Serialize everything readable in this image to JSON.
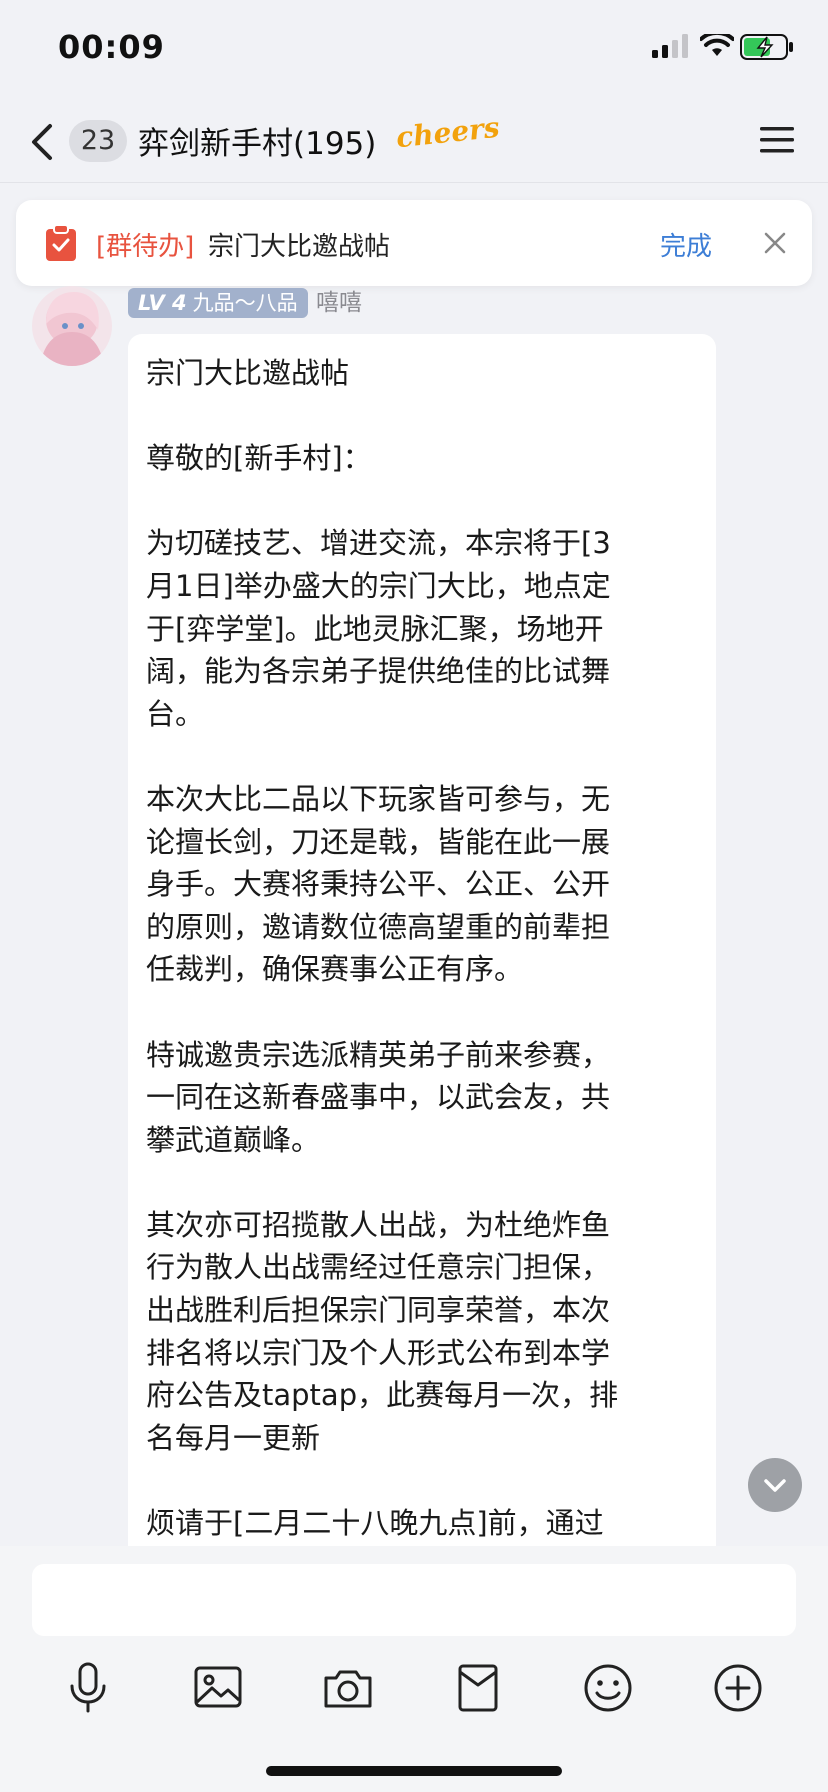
{
  "status": {
    "time": "00:09"
  },
  "nav": {
    "unread_count": "23",
    "title": "弈剑新手村(195)",
    "title_sticker": "cheers"
  },
  "todo": {
    "tag": "[群待办]",
    "text": "宗门大比邀战帖",
    "done_label": "完成"
  },
  "message": {
    "level_badge": "LV 4",
    "rank": "九品～八品",
    "nickname": "嘻嘻",
    "text": "宗门大比邀战帖\n\n尊敬的[新手村]：\n\n为切磋技艺、增进交流，本宗将于[3\n月1日]举办盛大的宗门大比，地点定\n于[弈学堂]。此地灵脉汇聚，场地开\n阔，能为各宗弟子提供绝佳的比试舞\n台。\n\n本次大比二品以下玩家皆可参与，无\n论擅长剑，刀还是戟，皆能在此一展\n身手。大赛将秉持公平、公正、公开\n的原则，邀请数位德高望重的前辈担\n任裁判，确保赛事公正有序。\n\n特诚邀贵宗选派精英弟子前来参赛，\n一同在这新春盛事中，以武会友，共\n攀武道巅峰。\n\n其次亦可招揽散人出战，为杜绝炸鱼\n行为散人出战需经过任意宗门担保，\n出战胜利后担保宗门同享荣誉，本次\n排名将以宗门及个人形式公布到本学\n府公告及taptap，此赛每月一次，排\n名每月一更新\n\n烦请于[二月二十八晚九点]前，通过"
  },
  "toolbar": {
    "icons": [
      "microphone-icon",
      "image-icon",
      "camera-icon",
      "red-packet-icon",
      "emoji-icon",
      "plus-icon"
    ]
  },
  "colors": {
    "accent": "#3d7ed6",
    "todo_tag": "#e8533f",
    "background": "#f1f2f6"
  }
}
